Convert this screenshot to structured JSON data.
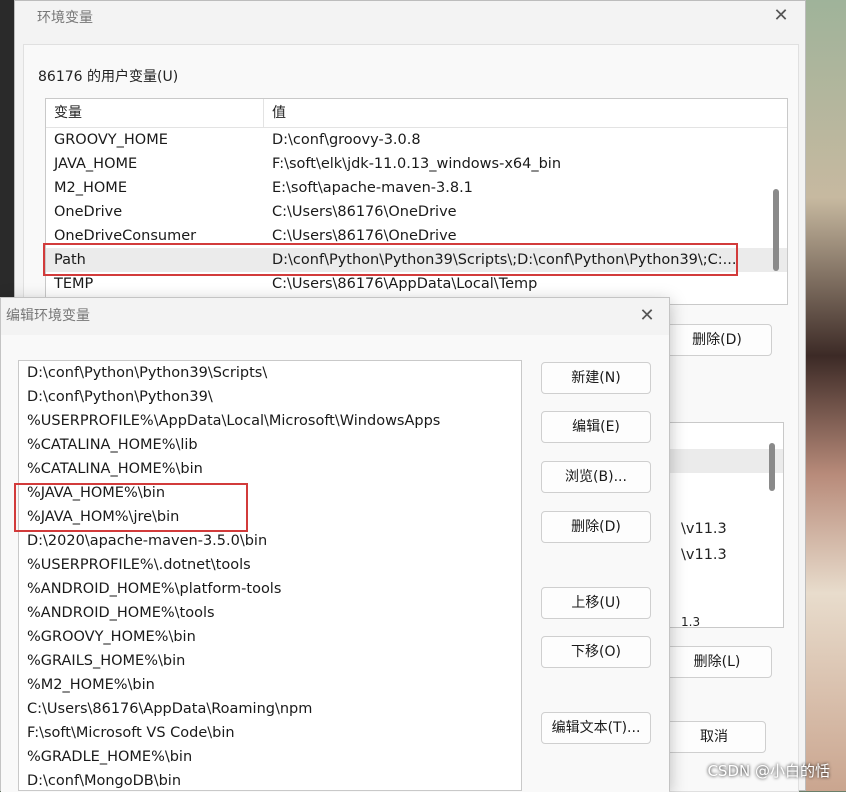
{
  "env_dialog": {
    "title": "环境变量",
    "close": "✕",
    "user_section_label": "86176 的用户变量(U)",
    "table_headers": [
      "变量",
      "值"
    ],
    "user_vars": [
      {
        "name": "GROOVY_HOME",
        "value": "D:\\conf\\groovy-3.0.8"
      },
      {
        "name": "JAVA_HOME",
        "value": "F:\\soft\\elk\\jdk-11.0.13_windows-x64_bin"
      },
      {
        "name": "M2_HOME",
        "value": "E:\\soft\\apache-maven-3.8.1"
      },
      {
        "name": "OneDrive",
        "value": "C:\\Users\\86176\\OneDrive"
      },
      {
        "name": "OneDriveConsumer",
        "value": "C:\\Users\\86176\\OneDrive"
      },
      {
        "name": "Path",
        "value": "D:\\conf\\Python\\Python39\\Scripts\\;D:\\conf\\Python\\Python39\\;C:..."
      },
      {
        "name": "TEMP",
        "value": "C:\\Users\\86176\\AppData\\Local\\Temp"
      }
    ],
    "delete_user_button": "删除(D)",
    "sys_values_partial": [
      "\\v11.3",
      "\\v11.3",
      "1.3"
    ],
    "delete_sys_button": "删除(L)",
    "cancel_button": "取消"
  },
  "edit_dialog": {
    "title": "编辑环境变量",
    "close": "✕",
    "paths": [
      "D:\\conf\\Python\\Python39\\Scripts\\",
      "D:\\conf\\Python\\Python39\\",
      "%USERPROFILE%\\AppData\\Local\\Microsoft\\WindowsApps",
      "%CATALINA_HOME%\\lib",
      "%CATALINA_HOME%\\bin",
      "%JAVA_HOME%\\bin",
      "%JAVA_HOM%\\jre\\bin",
      "D:\\2020\\apache-maven-3.5.0\\bin",
      "%USERPROFILE%\\.dotnet\\tools",
      "%ANDROID_HOME%\\platform-tools",
      "%ANDROID_HOME%\\tools",
      "%GROOVY_HOME%\\bin",
      "%GRAILS_HOME%\\bin",
      "%M2_HOME%\\bin",
      "C:\\Users\\86176\\AppData\\Roaming\\npm",
      "F:\\soft\\Microsoft VS Code\\bin",
      "%GRADLE_HOME%\\bin",
      "D:\\conf\\MongoDB\\bin"
    ],
    "buttons": {
      "new": "新建(N)",
      "edit": "编辑(E)",
      "browse": "浏览(B)...",
      "delete": "删除(D)",
      "move_up": "上移(U)",
      "move_down": "下移(O)",
      "edit_text": "编辑文本(T)..."
    }
  },
  "watermark": "CSDN @小白的恬"
}
